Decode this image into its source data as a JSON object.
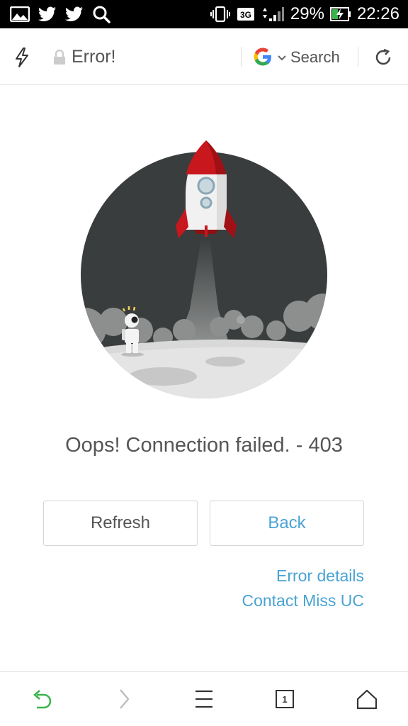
{
  "status_bar": {
    "left_icons": [
      "image-icon",
      "twitter-icon",
      "twitter-icon",
      "search-icon"
    ],
    "network": "3G",
    "battery": "29%",
    "time": "22:26"
  },
  "address_bar": {
    "title": "Error!",
    "search_engine": "google-icon",
    "search_label": "Search"
  },
  "error_page": {
    "message": "Oops! Connection failed. - 403",
    "refresh_label": "Refresh",
    "back_label": "Back",
    "error_details_label": "Error details",
    "contact_label": "Contact Miss UC"
  },
  "toolbar": {
    "tab_count": "1"
  },
  "colors": {
    "link": "#4aa3d4",
    "back_arrow": "#3cb34a",
    "rocket_red": "#c8171d",
    "sky": "#3a3d3d"
  }
}
